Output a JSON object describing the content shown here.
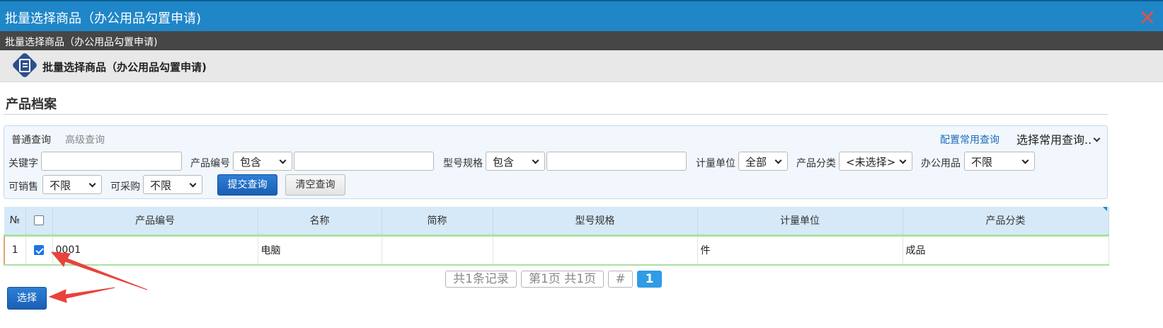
{
  "window": {
    "title": "批量选择商品（办公用品勾置申请)",
    "subtitle": "批量选择商品（办公用品勾置申请)"
  },
  "header": {
    "title": "批量选择商品（办公用品勾置申请)"
  },
  "section": {
    "title": "产品档案"
  },
  "query": {
    "tabs": [
      "普通查询",
      "高级查询"
    ],
    "config_link": "配置常用查询",
    "common_select": "选择常用查询..",
    "fields": {
      "keyword_label": "关键字",
      "keyword_value": "",
      "code_label": "产品编号",
      "code_op": "包含",
      "code_value": "",
      "spec_label": "型号规格",
      "spec_op": "包含",
      "spec_value": "",
      "unit_label": "计量单位",
      "unit_value": "全部",
      "category_label": "产品分类",
      "category_value": "<未选择>",
      "office_label": "办公用品",
      "office_value": "不限",
      "sellable_label": "可销售",
      "sellable_value": "不限",
      "purchasable_label": "可采购",
      "purchasable_value": "不限"
    },
    "submit_label": "提交查询",
    "clear_label": "清空查询"
  },
  "table": {
    "columns": [
      "№",
      "",
      "产品编号",
      "名称",
      "简称",
      "型号规格",
      "计量单位",
      "产品分类"
    ],
    "rows": [
      {
        "no": "1",
        "checked": true,
        "code": "0001",
        "name": "电脑",
        "short": "",
        "spec": "",
        "unit": "件",
        "category": "成品"
      }
    ]
  },
  "pagination": {
    "records": "共1条记录",
    "pages": "第1页 共1页",
    "hash": "#",
    "current": "1"
  },
  "footer": {
    "select_label": "选择"
  },
  "colors": {
    "titlebar": "#1f86c8",
    "subbar": "#464646",
    "annotation_arrow": "#e8433a"
  }
}
